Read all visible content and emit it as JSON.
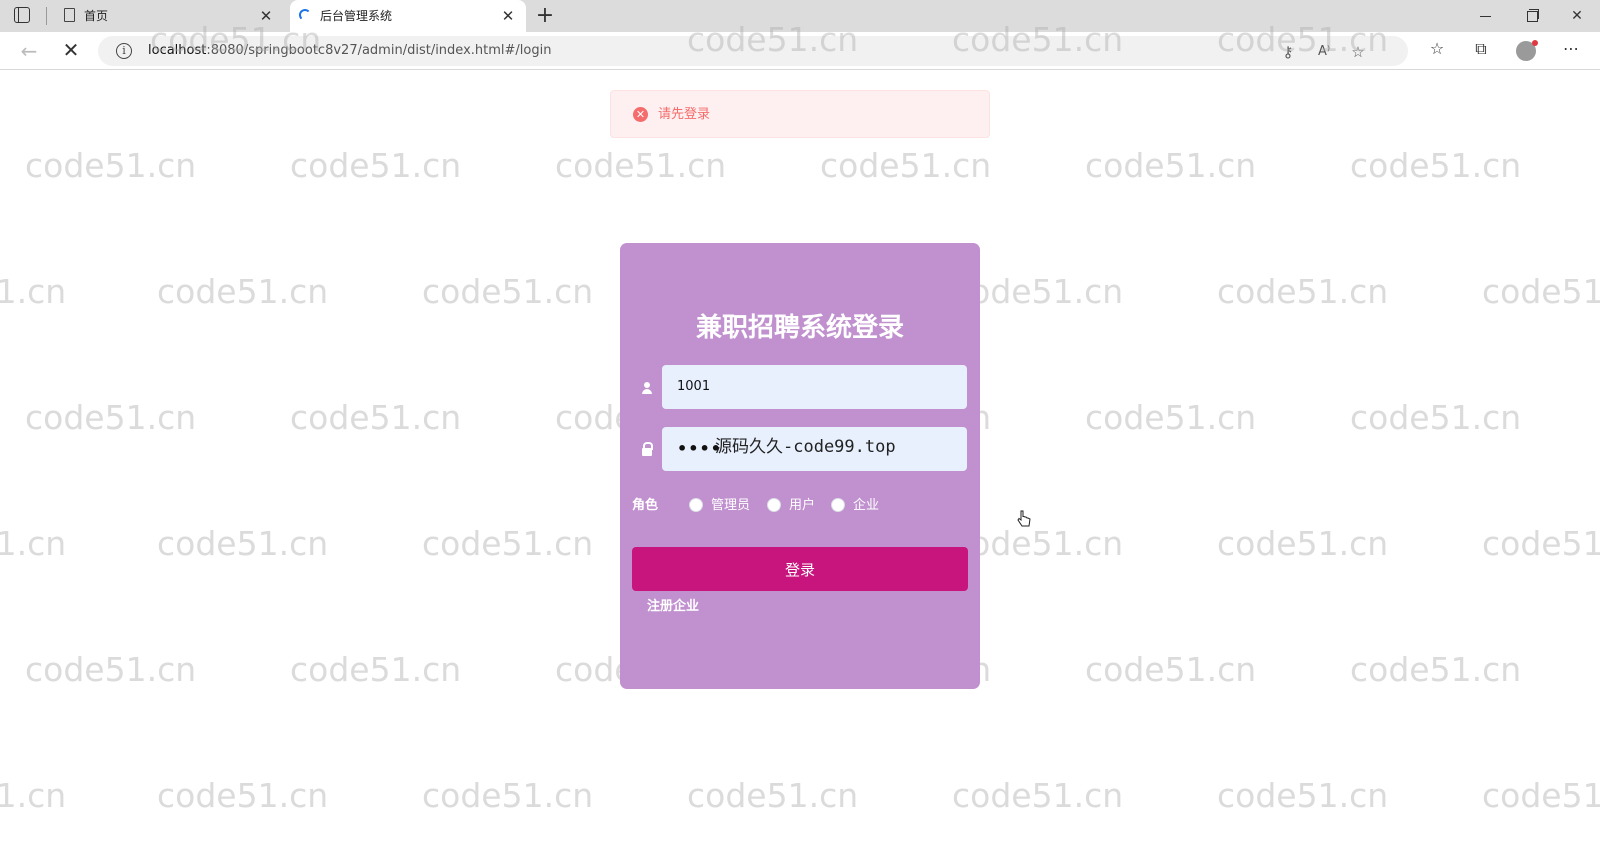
{
  "browser": {
    "tabs": [
      {
        "title": "首页",
        "active": false,
        "icon": "page-icon"
      },
      {
        "title": "后台管理系统",
        "active": true,
        "icon": "loading-spinner-icon"
      }
    ],
    "new_tab_symbol": "+",
    "url_host": "localhost",
    "url_rest": ":8080/springbootc8v27/admin/dist/index.html#/login"
  },
  "alert": {
    "type": "error",
    "message": "请先登录"
  },
  "login": {
    "title": "兼职招聘系统登录",
    "username_value": "1001",
    "password_mask": "••••",
    "password_overlay": "源码久久-code99.top",
    "role_label": "角色",
    "roles": [
      "管理员",
      "用户",
      "企业"
    ],
    "submit_label": "登录",
    "register_label": "注册企业"
  },
  "watermark": "code51.cn",
  "colors": {
    "card_bg": "#c090cf",
    "button_bg": "#c8157e",
    "input_bg": "#e8f0fe",
    "alert_bg": "#fef0f0",
    "alert_text": "#f56c6c"
  }
}
